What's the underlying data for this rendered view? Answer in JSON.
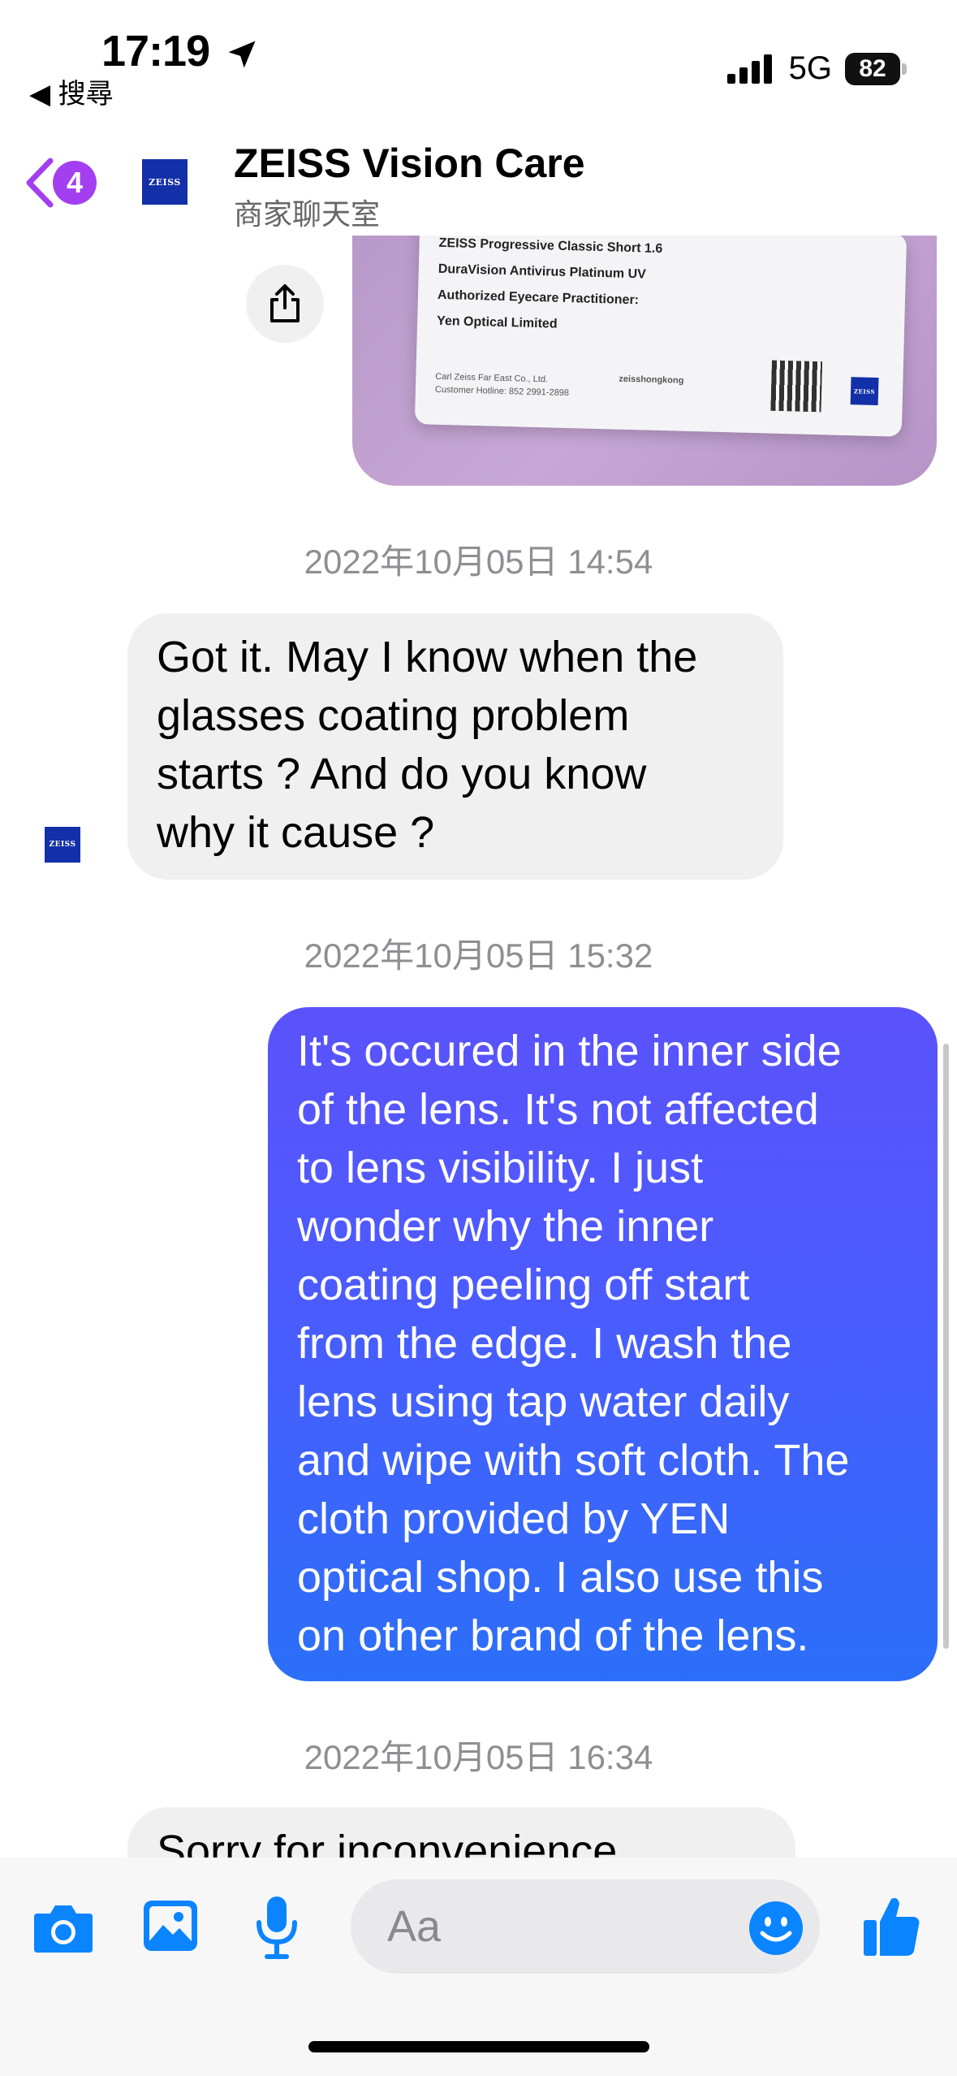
{
  "status_bar": {
    "time": "17:19",
    "back_app": "◀ 搜尋",
    "network": "5G",
    "battery": "82"
  },
  "header": {
    "unread_count": "4",
    "title": "ZEISS Vision Care",
    "subtitle": "商家聊天室",
    "logo_text": "ZEISS"
  },
  "photo_card": {
    "lines": [
      "ZEISS Progressive Classic Short 1.6",
      "DuraVision Antivirus Platinum UV",
      "Authorized Eyecare Practitioner:",
      "Yen Optical Limited"
    ],
    "company": "Carl Zeiss Far East Co., Ltd.",
    "hotline": "Customer Hotline: 852 2991-2898",
    "social": "zeisshongkong"
  },
  "messages": [
    {
      "type": "timestamp",
      "text": "2022年10月05日 14:54"
    },
    {
      "type": "incoming",
      "lines": [
        "Got it. May I know when the",
        "glasses coating problem",
        "starts ? And do you know",
        "why it cause ?"
      ]
    },
    {
      "type": "timestamp",
      "text": "2022年10月05日 15:32"
    },
    {
      "type": "outgoing",
      "lines": [
        "It's occured in the inner side",
        "of the lens. It's not affected",
        "to lens visibility. I just",
        "wonder why the inner",
        "coating peeling off start",
        "from the edge. I wash the",
        "lens using tap water daily",
        "and wipe with soft cloth. The",
        "cloth provided by YEN",
        "optical shop. I also use this",
        "on other brand of the lens."
      ]
    },
    {
      "type": "timestamp",
      "text": "2022年10月05日 16:34"
    },
    {
      "type": "incoming_partial",
      "lines": [
        "Sorry for inconvenience"
      ]
    }
  ],
  "composer": {
    "placeholder": "Aa"
  },
  "colors": {
    "accent": "#a33ff0",
    "messenger_blue": "#0a84ff",
    "bubble_out_top": "#5b52fb",
    "bubble_out_bottom": "#2b6ff8",
    "bubble_in": "#f0f0f0",
    "zeiss_blue": "#1330a8"
  },
  "icons": [
    "location-arrow-icon",
    "signal-icon",
    "battery-icon",
    "chevron-left-icon",
    "share-icon",
    "camera-icon",
    "photo-icon",
    "microphone-icon",
    "emoji-icon",
    "thumbs-up-icon"
  ]
}
